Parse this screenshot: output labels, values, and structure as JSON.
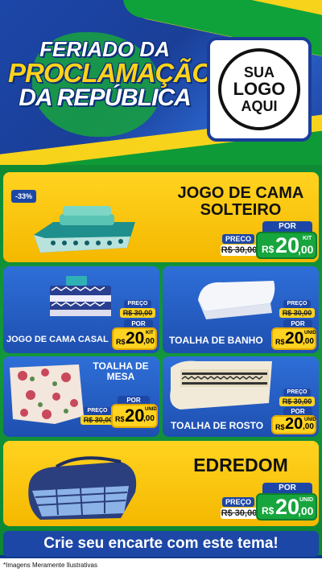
{
  "header": {
    "title_line1": "FERIADO DA",
    "title_line2": "PROCLAMAÇÃO",
    "title_line3": "DA REPÚBLICA",
    "logo_line1": "SUA",
    "logo_line2": "LOGO",
    "logo_line3": "AQUI"
  },
  "products": [
    {
      "name_line1": "JOGO DE CAMA",
      "name_line2": "SOLTEIRO",
      "badge": "-33%",
      "preco_label": "PRECO",
      "old_price": "R$ 30,00",
      "por_label": "POR",
      "currency": "R$",
      "price_int": "20",
      "price_cents": ",00",
      "unit": "KIT"
    },
    {
      "name": "JOGO DE CAMA CASAL",
      "preco_label": "PREÇO",
      "old_price": "R$ 30,00",
      "por_label": "POR",
      "currency": "R$",
      "price_int": "20",
      "price_cents": ",00",
      "unit": "KIT"
    },
    {
      "name": "TOALHA DE BANHO",
      "preco_label": "PREÇO",
      "old_price": "R$ 30,00",
      "por_label": "POR",
      "currency": "R$",
      "price_int": "20",
      "price_cents": ",00",
      "unit": "UNID"
    },
    {
      "name_line1": "TOALHA DE",
      "name_line2": "MESA",
      "preco_label": "PREÇO",
      "old_price": "R$ 30,00",
      "por_label": "POR",
      "currency": "R$",
      "price_int": "20",
      "price_cents": ",00",
      "unit": "UNID"
    },
    {
      "name": "TOALHA DE ROSTO",
      "preco_label": "PREÇO",
      "old_price": "R$ 30,00",
      "por_label": "POR",
      "currency": "R$",
      "price_int": "20",
      "price_cents": ",00",
      "unit": "UNID"
    },
    {
      "name": "EDREDOM",
      "preco_label": "PREÇO",
      "old_price": "R$ 30,00",
      "por_label": "POR",
      "currency": "R$",
      "price_int": "20",
      "price_cents": ",00",
      "unit": "UNID"
    }
  ],
  "footer": {
    "cta": "Crie seu encarte com este tema!",
    "note": "*Imagens Meramente Ilustrativas"
  }
}
